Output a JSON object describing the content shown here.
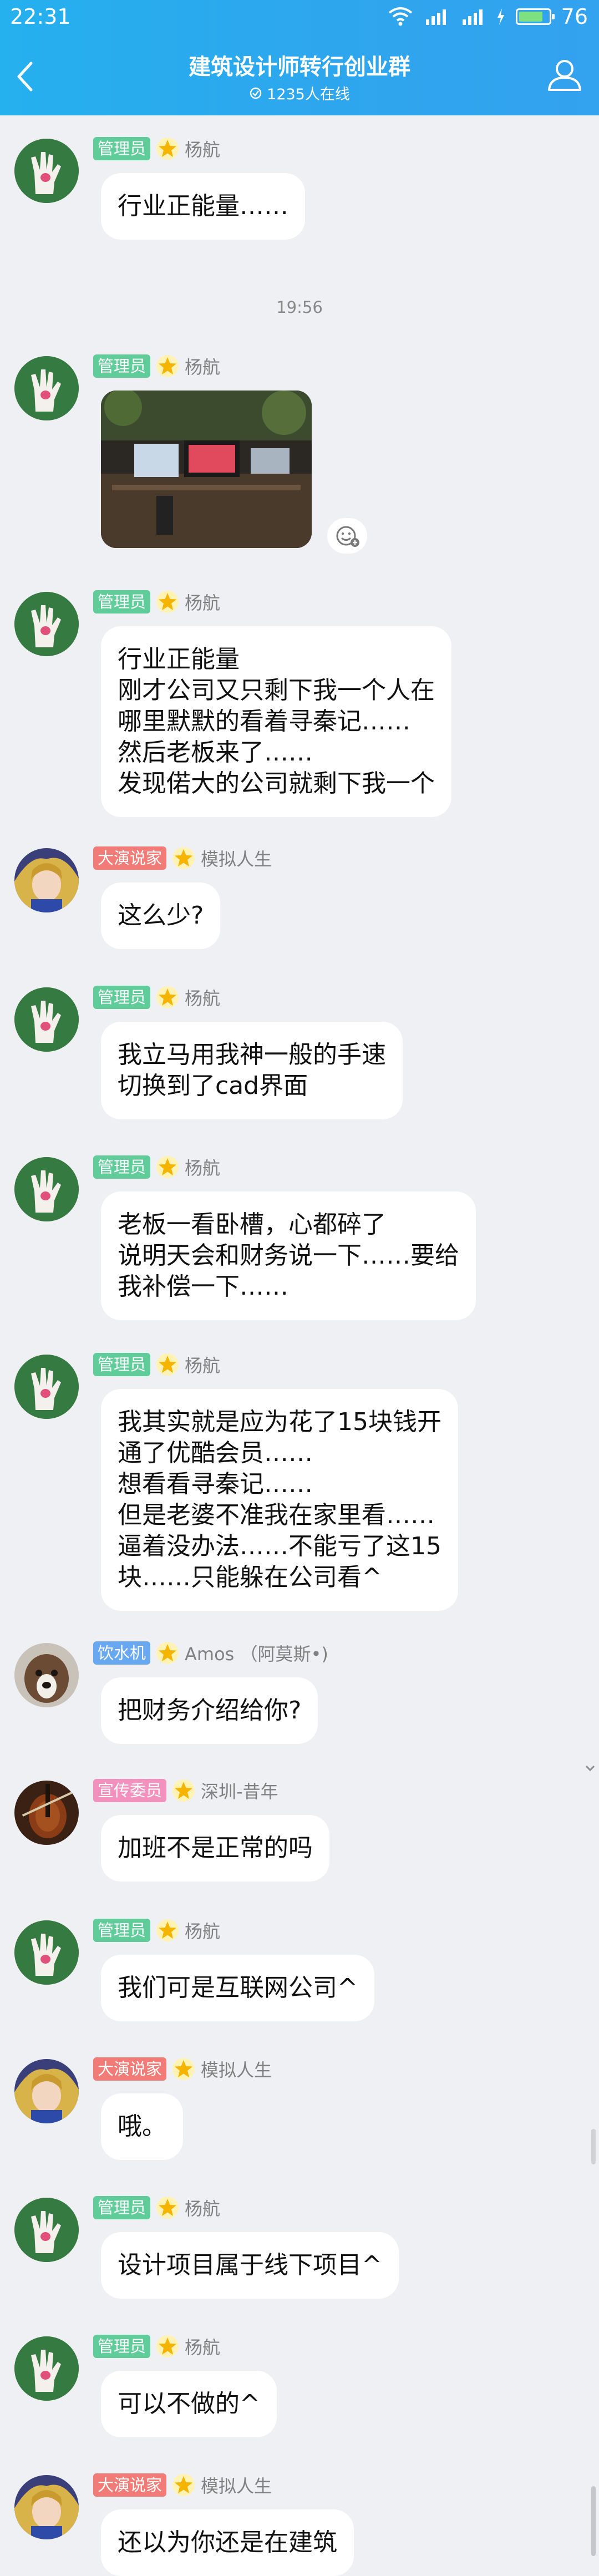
{
  "status_bar": {
    "time": "22:31",
    "battery": "76"
  },
  "header": {
    "title": "建筑设计师转行创业群",
    "online": "1235人在线"
  },
  "timestamp": "19:56",
  "messages": [
    {
      "badge": "管理员",
      "name": "杨航",
      "text": "行业正能量……"
    },
    {
      "badge": "管理员",
      "name": "杨航",
      "text": ""
    },
    {
      "badge": "管理员",
      "name": "杨航",
      "text": "行业正能量\n刚才公司又只剩下我一个人在\n哪里默默的看着寻秦记……\n然后老板来了……\n发现偌大的公司就剩下我一个"
    },
    {
      "badge": "大演说家",
      "name": "模拟人生",
      "text": "这么少?"
    },
    {
      "badge": "管理员",
      "name": "杨航",
      "text": "我立马用我神一般的手速\n切换到了cad界面"
    },
    {
      "badge": "管理员",
      "name": "杨航",
      "text": "老板一看卧槽，心都碎了\n说明天会和财务说一下……要给\n我补偿一下……"
    },
    {
      "badge": "管理员",
      "name": "杨航",
      "text": "我其实就是应为花了15块钱开\n通了优酷会员……\n想看看寻秦记……\n但是老婆不准我在家里看……\n逼着没办法……不能亏了这15\n块……只能躲在公司看^"
    },
    {
      "badge": "饮水机",
      "name": "Amos （阿莫斯•)",
      "text": "把财务介绍给你?"
    },
    {
      "badge": "宣传委员",
      "name": "深圳-昔年",
      "text": "加班不是正常的吗"
    },
    {
      "badge": "管理员",
      "name": "杨航",
      "text": "我们可是互联网公司^"
    },
    {
      "badge": "大演说家",
      "name": "模拟人生",
      "text": "哦。"
    },
    {
      "badge": "管理员",
      "name": "杨航",
      "text": "设计项目属于线下项目^"
    },
    {
      "badge": "管理员",
      "name": "杨航",
      "text": "可以不做的^"
    },
    {
      "badge": "大演说家",
      "name": "模拟人生",
      "text": "还以为你还是在建筑"
    }
  ]
}
